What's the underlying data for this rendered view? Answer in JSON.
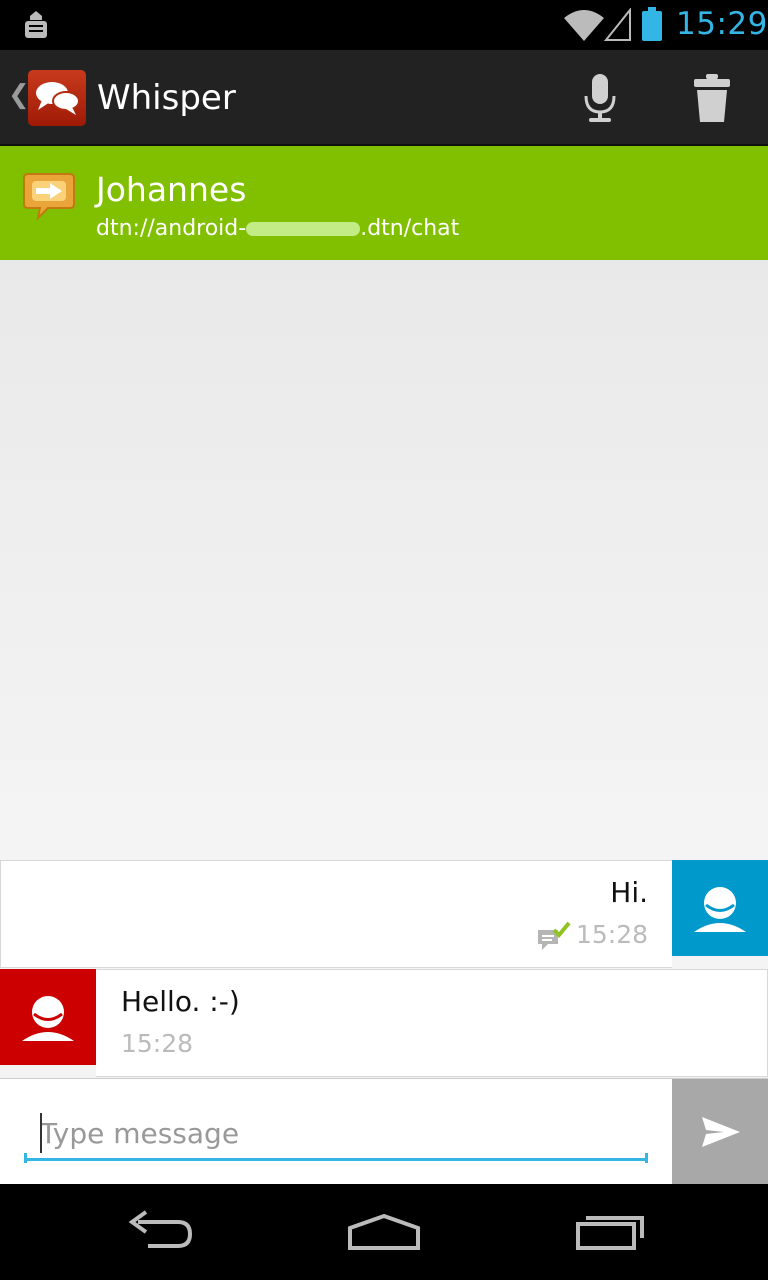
{
  "status_bar": {
    "time": "15:29",
    "icons": [
      "notification-icon",
      "wifi-icon",
      "cell-signal-icon",
      "battery-icon"
    ]
  },
  "action_bar": {
    "title": "Whisper",
    "icons": [
      "up-icon",
      "app-logo-icon",
      "microphone-icon",
      "trash-icon"
    ]
  },
  "contact": {
    "name": "Johannes",
    "address_prefix": "dtn://android-",
    "address_suffix": ".dtn/chat"
  },
  "messages": [
    {
      "direction": "outgoing",
      "text": "Hi.",
      "time": "15:28",
      "status_icon": "delivered-check-icon"
    },
    {
      "direction": "incoming",
      "text": "Hello. :-)",
      "time": "15:28"
    }
  ],
  "composer": {
    "placeholder": "Type message",
    "send_icon": "send-icon"
  },
  "nav_bar": {
    "icons": [
      "back-icon",
      "home-icon",
      "recents-icon"
    ]
  },
  "colors": {
    "accent": "#33b5e5",
    "contact_bar": "#80c000",
    "outgoing_avatar": "#0099cc",
    "incoming_avatar": "#cc0000"
  }
}
